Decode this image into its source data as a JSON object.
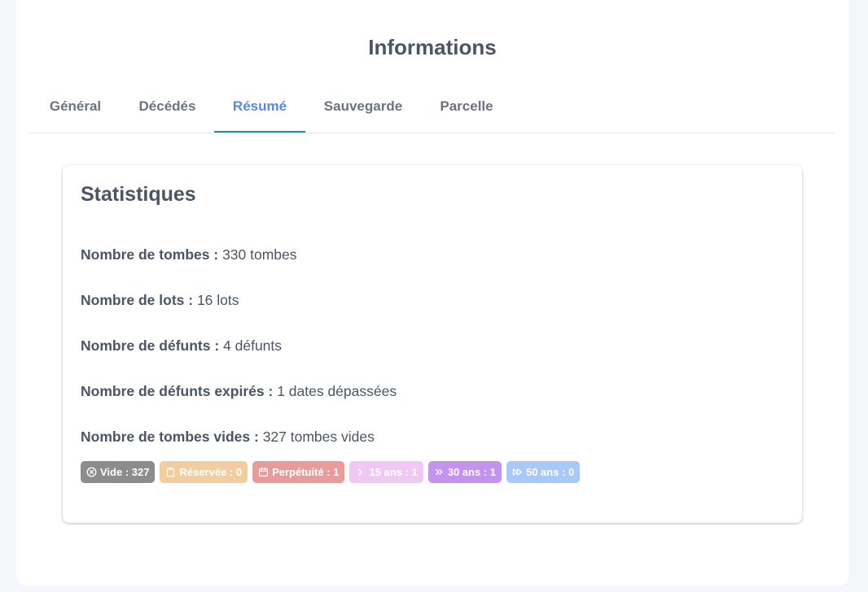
{
  "page": {
    "title": "Informations"
  },
  "tabs": [
    {
      "label": "Général",
      "active": false
    },
    {
      "label": "Décédés",
      "active": false
    },
    {
      "label": "Résumé",
      "active": true
    },
    {
      "label": "Sauvegarde",
      "active": false
    },
    {
      "label": "Parcelle",
      "active": false
    }
  ],
  "card": {
    "title": "Statistiques",
    "stats": [
      {
        "label": "Nombre de tombes :",
        "value": "330 tombes"
      },
      {
        "label": "Nombre de lots :",
        "value": "16 lots"
      },
      {
        "label": "Nombre de défunts :",
        "value": "4 défunts"
      },
      {
        "label": "Nombre de défunts expirés :",
        "value": "1 dates dépassées"
      },
      {
        "label": "Nombre de tombes vides :",
        "value": "327 tombes vides"
      }
    ],
    "badges": [
      {
        "label": "Vide : 327",
        "icon": "circle-x-icon",
        "color": "#8c8c8c"
      },
      {
        "label": "Réservée : 0",
        "icon": "clipboard-icon",
        "color": "#f2cd9e"
      },
      {
        "label": "Perpétuité : 1",
        "icon": "calendar-icon",
        "color": "#e89b99"
      },
      {
        "label": "15 ans : 1",
        "icon": "chevron-right-icon",
        "color": "#f0c8f4"
      },
      {
        "label": "30 ans : 1",
        "icon": "double-chevron-right-icon",
        "color": "#c493f0"
      },
      {
        "label": "50 ans : 0",
        "icon": "fast-forward-icon",
        "color": "#a8c9f7"
      }
    ]
  },
  "colors": {
    "text": "#4b5563",
    "tab_inactive": "#6b7280",
    "tab_active": "#5b85e6",
    "tab_underline": "#2f8a8f",
    "background": "#f4f6f9"
  }
}
